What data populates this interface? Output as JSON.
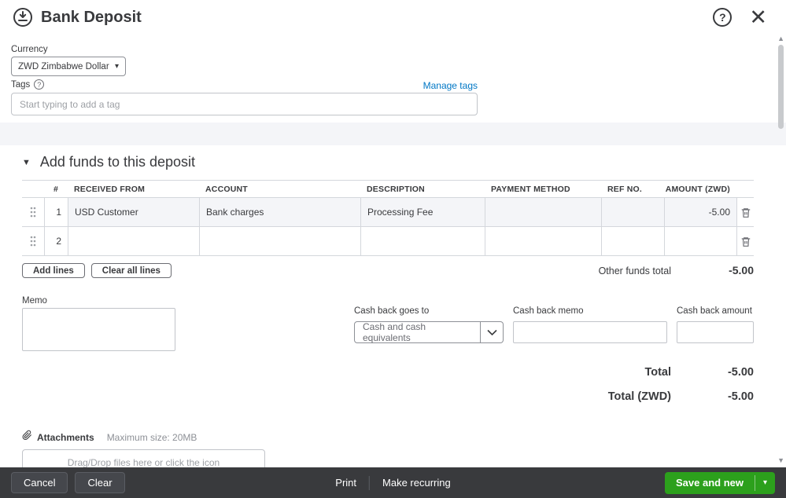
{
  "header": {
    "title": "Bank Deposit"
  },
  "icons": {
    "help": "?",
    "close": "✕",
    "collapse_triangle": "▼",
    "caret_down": "▾",
    "tags_info": "?",
    "scroll_up": "▲",
    "scroll_down": "▼"
  },
  "form": {
    "currency": {
      "label": "Currency",
      "value": "ZWD Zimbabwe Dollar"
    },
    "tags": {
      "label": "Tags",
      "manage_link": "Manage tags",
      "placeholder": "Start typing to add a tag"
    }
  },
  "deposit_section": {
    "title": "Add funds to this deposit",
    "table": {
      "columns": {
        "num": "#",
        "received_from": "RECEIVED FROM",
        "account": "ACCOUNT",
        "description": "DESCRIPTION",
        "payment_method": "PAYMENT METHOD",
        "ref_no": "REF NO.",
        "amount": "AMOUNT (ZWD)"
      },
      "rows": [
        {
          "num": "1",
          "received_from": "USD Customer",
          "account": "Bank charges",
          "description": "Processing Fee",
          "payment_method": "",
          "ref_no": "",
          "amount": "-5.00"
        },
        {
          "num": "2",
          "received_from": "",
          "account": "",
          "description": "",
          "payment_method": "",
          "ref_no": "",
          "amount": ""
        }
      ]
    },
    "add_lines": "Add lines",
    "clear_all_lines": "Clear all lines",
    "other_funds_total": {
      "label": "Other funds total",
      "value": "-5.00"
    }
  },
  "memo": {
    "label": "Memo"
  },
  "cash_back": {
    "goes_to": {
      "label": "Cash back goes to",
      "value": "Cash and cash equivalents"
    },
    "memo": {
      "label": "Cash back memo"
    },
    "amount": {
      "label": "Cash back amount"
    }
  },
  "totals": {
    "total": {
      "label": "Total",
      "value": "-5.00"
    },
    "total_zwd": {
      "label": "Total (ZWD)",
      "value": "-5.00"
    }
  },
  "attachments": {
    "label": "Attachments",
    "max_size": "Maximum size: 20MB",
    "dropzone_text": "Drag/Drop files here or click the icon"
  },
  "footer": {
    "cancel": "Cancel",
    "clear": "Clear",
    "print": "Print",
    "make_recurring": "Make recurring",
    "save_and_new": "Save and new"
  },
  "colors": {
    "accent_green": "#2ca01c",
    "link_blue": "#0077c5",
    "footer_bg": "#393a3d",
    "row_fill": "#f4f5f8"
  }
}
